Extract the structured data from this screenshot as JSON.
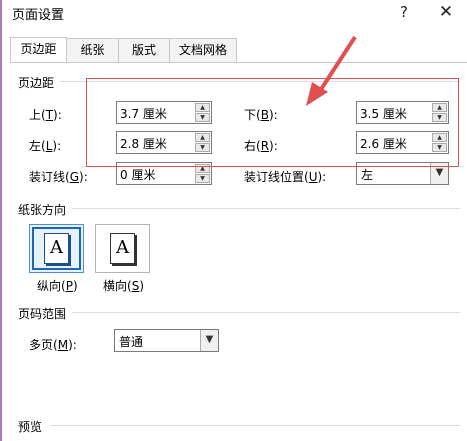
{
  "window": {
    "title": "页面设置",
    "help_glyph": "?",
    "close_glyph": "✕"
  },
  "tabs": [
    {
      "label": "页边距",
      "active": true
    },
    {
      "label": "纸张",
      "active": false
    },
    {
      "label": "版式",
      "active": false
    },
    {
      "label": "文档网格",
      "active": false
    }
  ],
  "margins": {
    "section_title": "页边距",
    "top": {
      "label": "上",
      "key": "T",
      "value": "3.7 厘米"
    },
    "bottom": {
      "label": "下",
      "key": "B",
      "value": "3.5 厘米"
    },
    "left": {
      "label": "左",
      "key": "L",
      "value": "2.8 厘米"
    },
    "right": {
      "label": "右",
      "key": "R",
      "value": "2.6 厘米"
    },
    "gutter": {
      "label": "装订线",
      "key": "G",
      "value": "0 厘米"
    },
    "gutter_position": {
      "label": "装订线位置",
      "key": "U",
      "value": "左"
    }
  },
  "orientation": {
    "section_title": "纸张方向",
    "portrait": {
      "label": "纵向",
      "key": "P",
      "glyph": "A",
      "selected": true
    },
    "landscape": {
      "label": "横向",
      "key": "S",
      "glyph": "A",
      "selected": false
    }
  },
  "pages": {
    "section_title": "页码范围",
    "multiple": {
      "label": "多页",
      "key": "M",
      "value": "普通"
    }
  },
  "preview": {
    "section_title": "预览"
  },
  "colors": {
    "annotation_red": "#e05050",
    "selected_blue": "#1f66b5"
  }
}
